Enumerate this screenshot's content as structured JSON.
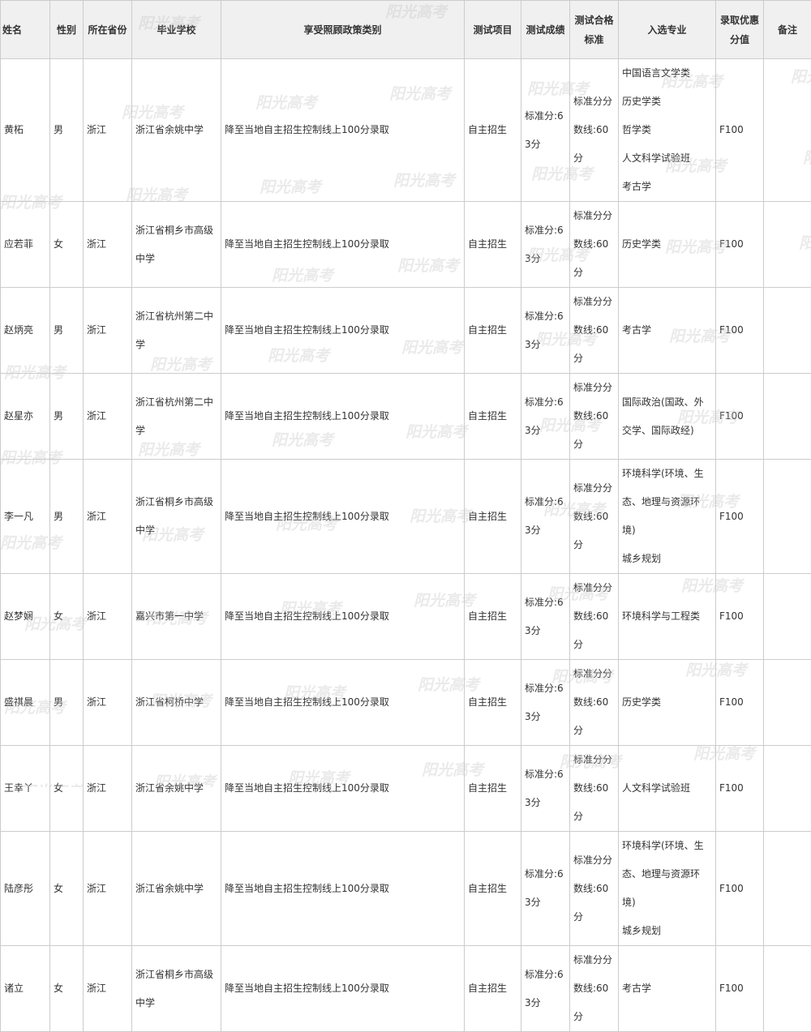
{
  "headers": [
    "姓名",
    "性别",
    "所在省份",
    "毕业学校",
    "享受照顾政策类别",
    "测试项目",
    "测试成绩",
    "测试合格标准",
    "入选专业",
    "录取优惠分值",
    "备注"
  ],
  "rows": [
    {
      "name": "黄柘",
      "gender": "男",
      "province": "浙江",
      "school": "浙江省余姚中学",
      "policy": "降至当地自主招生控制线上100分录取",
      "item": "自主招生",
      "score": "标准分:63分",
      "standard": "标准分分数线:60分",
      "majors": [
        "中国语言文学类",
        "历史学类",
        "哲学类",
        "人文科学试验班",
        "考古学"
      ],
      "bonus": "F100",
      "note": ""
    },
    {
      "name": "应若菲",
      "gender": "女",
      "province": "浙江",
      "school": "浙江省桐乡市高级中学",
      "policy": "降至当地自主招生控制线上100分录取",
      "item": "自主招生",
      "score": "标准分:63分",
      "standard": "标准分分数线:60分",
      "majors": [
        "历史学类"
      ],
      "bonus": "F100",
      "note": ""
    },
    {
      "name": "赵炳亮",
      "gender": "男",
      "province": "浙江",
      "school": "浙江省杭州第二中学",
      "policy": "降至当地自主招生控制线上100分录取",
      "item": "自主招生",
      "score": "标准分:63分",
      "standard": "标准分分数线:60分",
      "majors": [
        "考古学"
      ],
      "bonus": "F100",
      "note": ""
    },
    {
      "name": "赵星亦",
      "gender": "男",
      "province": "浙江",
      "school": "浙江省杭州第二中学",
      "policy": "降至当地自主招生控制线上100分录取",
      "item": "自主招生",
      "score": "标准分:63分",
      "standard": "标准分分数线:60分",
      "majors": [
        "国际政治(国政、外交学、国际政经)"
      ],
      "bonus": "F100",
      "note": ""
    },
    {
      "name": "李一凡",
      "gender": "男",
      "province": "浙江",
      "school": "浙江省桐乡市高级中学",
      "policy": "降至当地自主招生控制线上100分录取",
      "item": "自主招生",
      "score": "标准分:63分",
      "standard": "标准分分数线:60分",
      "majors": [
        "环境科学(环境、生态、地理与资源环境)",
        "城乡规划"
      ],
      "bonus": "F100",
      "note": ""
    },
    {
      "name": "赵梦娴",
      "gender": "女",
      "province": "浙江",
      "school": "嘉兴市第一中学",
      "policy": "降至当地自主招生控制线上100分录取",
      "item": "自主招生",
      "score": "标准分:63分",
      "standard": "标准分分数线:60分",
      "majors": [
        "环境科学与工程类"
      ],
      "bonus": "F100",
      "note": ""
    },
    {
      "name": "盛祺晨",
      "gender": "男",
      "province": "浙江",
      "school": "浙江省柯桥中学",
      "policy": "降至当地自主招生控制线上100分录取",
      "item": "自主招生",
      "score": "标准分:63分",
      "standard": "标准分分数线:60分",
      "majors": [
        "历史学类"
      ],
      "bonus": "F100",
      "note": ""
    },
    {
      "name": "王幸丫",
      "gender": "女",
      "province": "浙江",
      "school": "浙江省余姚中学",
      "policy": "降至当地自主招生控制线上100分录取",
      "item": "自主招生",
      "score": "标准分:63分",
      "standard": "标准分分数线:60分",
      "majors": [
        "人文科学试验班"
      ],
      "bonus": "F100",
      "note": ""
    },
    {
      "name": "陆彦彤",
      "gender": "女",
      "province": "浙江",
      "school": "浙江省余姚中学",
      "policy": "降至当地自主招生控制线上100分录取",
      "item": "自主招生",
      "score": "标准分:63分",
      "standard": "标准分分数线:60分",
      "majors": [
        "环境科学(环境、生态、地理与资源环境)",
        "城乡规划"
      ],
      "bonus": "F100",
      "note": ""
    },
    {
      "name": "诸立",
      "gender": "女",
      "province": "浙江",
      "school": "浙江省桐乡市高级中学",
      "policy": "降至当地自主招生控制线上100分录取",
      "item": "自主招生",
      "score": "标准分:63分",
      "standard": "标准分分数线:60分",
      "majors": [
        "考古学"
      ],
      "bonus": "F100",
      "note": ""
    }
  ],
  "watermark_text": "阳光高考"
}
